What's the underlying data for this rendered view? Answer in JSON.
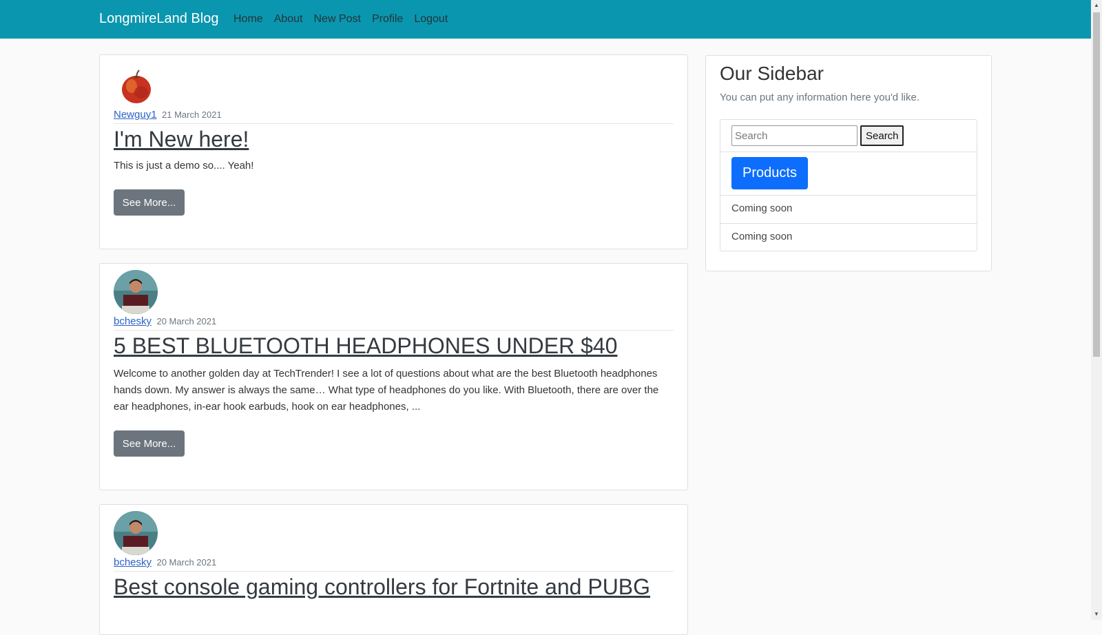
{
  "navbar": {
    "brand": "LongmireLand Blog",
    "links": [
      "Home",
      "About",
      "New Post",
      "Profile",
      "Logout"
    ],
    "background": "#0b96af"
  },
  "posts": [
    {
      "avatar_icon": "apple-avatar",
      "author": "Newguy1",
      "date": "21 March 2021",
      "title": "I'm New here!",
      "excerpt": "This is just a demo so.... Yeah!",
      "button": "See More..."
    },
    {
      "avatar_icon": "user-photo-avatar",
      "author": "bchesky",
      "date": "20 March 2021",
      "title": "5 BEST BLUETOOTH HEADPHONES UNDER $40",
      "excerpt": "Welcome to another golden day at TechTrender! I see a lot of questions about what are the best Bluetooth headphones hands down. My answer is always the same… What type of headphones do you like. With Bluetooth, there are over the ear headphones, in-ear hook earbuds, hook on ear headphones, ...",
      "button": "See More..."
    },
    {
      "avatar_icon": "user-photo-avatar",
      "author": "bchesky",
      "date": "20 March 2021",
      "title": "Best console gaming controllers for Fortnite and PUBG"
    }
  ],
  "sidebar": {
    "title": "Our Sidebar",
    "subtitle": "You can put any information here you'd like.",
    "search_placeholder": "Search",
    "search_button": "Search",
    "products_button": "Products",
    "items": [
      "Coming soon",
      "Coming soon"
    ],
    "accent": "#0d6efd"
  },
  "colors": {
    "button_gray": "#6c757d",
    "link_blue": "#2b62c8"
  }
}
